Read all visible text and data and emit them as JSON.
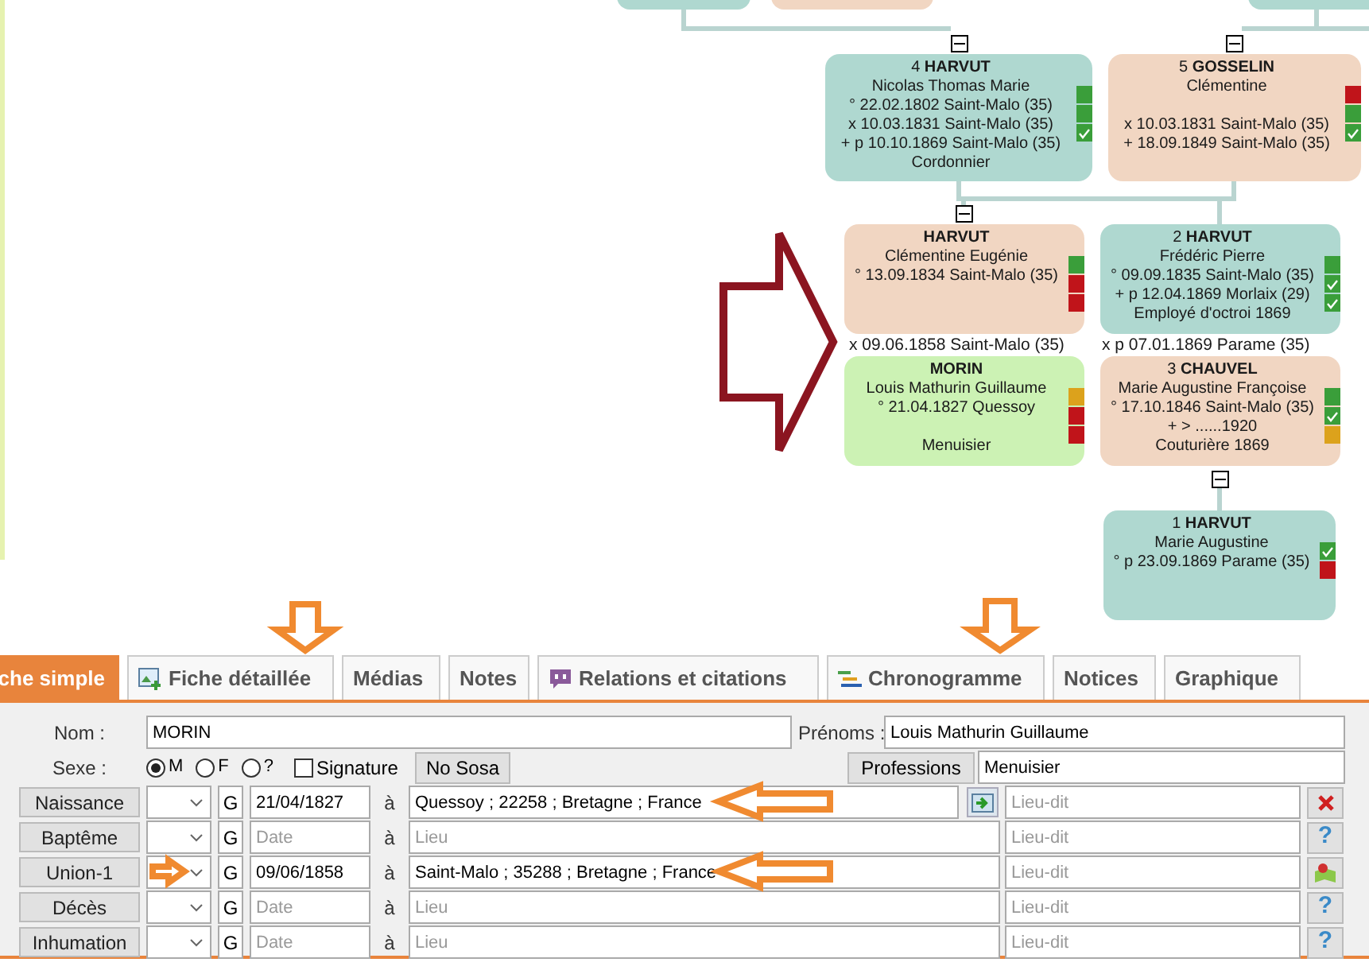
{
  "tree": {
    "nodes": [
      {
        "sosa": "4",
        "surname": "HARVUT",
        "given": "Nicolas Thomas Marie",
        "birth": "° 22.02.1802 Saint-Malo (35)",
        "marriage": "x 10.03.1831 Saint-Malo (35)",
        "death": "+ p 10.10.1869 Saint-Malo (35)",
        "occupation": "Cordonnier",
        "color": "#afd8d0",
        "markers": [
          {
            "color": "#3a9e3a",
            "checked": false
          },
          {
            "color": "#3a9e3a",
            "checked": false
          },
          {
            "color": "#3a9e3a",
            "checked": true
          }
        ]
      },
      {
        "sosa": "5",
        "surname": "GOSSELIN",
        "given": "Clémentine",
        "marriage": "x 10.03.1831 Saint-Malo (35)",
        "death": "+ 18.09.1849 Saint-Malo (35)",
        "color": "#f1d6c2",
        "markers": [
          {
            "color": "#c0141a",
            "checked": false
          },
          {
            "color": "#3a9e3a",
            "checked": false
          },
          {
            "color": "#3a9e3a",
            "checked": true
          }
        ]
      },
      {
        "surname": "HARVUT",
        "given": "Clémentine Eugénie",
        "birth": "° 13.09.1834 Saint-Malo (35)",
        "color": "#f1d6c2",
        "markers": [
          {
            "color": "#3a9e3a",
            "checked": false
          },
          {
            "color": "#c0141a",
            "checked": false
          },
          {
            "color": "#c0141a",
            "checked": false
          }
        ]
      },
      {
        "sosa": "2",
        "surname": "HARVUT",
        "given": "Frédéric Pierre",
        "birth": "° 09.09.1835 Saint-Malo (35)",
        "death": "+ p 12.04.1869 Morlaix (29)",
        "occupation": "Employé d'octroi 1869",
        "color": "#afd8d0",
        "markers": [
          {
            "color": "#3a9e3a",
            "checked": false
          },
          {
            "color": "#3a9e3a",
            "checked": true
          },
          {
            "color": "#3a9e3a",
            "checked": true
          }
        ]
      },
      {
        "surname": "MORIN",
        "given": "Louis Mathurin Guillaume",
        "birth": "° 21.04.1827 Quessoy",
        "occupation": "Menuisier",
        "color": "#ccf2b4",
        "markers": [
          {
            "color": "#dca21c",
            "checked": false
          },
          {
            "color": "#c0141a",
            "checked": false
          },
          {
            "color": "#c0141a",
            "checked": false
          }
        ]
      },
      {
        "sosa": "3",
        "surname": "CHAUVEL",
        "given": "Marie Augustine Françoise",
        "birth": "° 17.10.1846 Saint-Malo (35)",
        "death": "+ > ......1920",
        "occupation": "Couturière 1869",
        "color": "#f1d6c2",
        "markers": [
          {
            "color": "#3a9e3a",
            "checked": false
          },
          {
            "color": "#3a9e3a",
            "checked": true
          },
          {
            "color": "#dca21c",
            "checked": false
          }
        ]
      },
      {
        "sosa": "1",
        "surname": "HARVUT",
        "given": "Marie Augustine",
        "birth": "° p 23.09.1869 Parame (35)",
        "color": "#afd8d0",
        "markers": [
          {
            "color": "#3a9e3a",
            "checked": true
          },
          {
            "color": "#c0141a",
            "checked": false
          }
        ]
      }
    ],
    "unions": [
      "x 09.06.1858 Saint-Malo (35)",
      "x p 07.01.1869 Parame (35)"
    ]
  },
  "tabs": [
    {
      "label": "che simple",
      "selected": true
    },
    {
      "label": "Fiche détaillée",
      "selected": false,
      "kind": "card"
    },
    {
      "label": "Médias",
      "selected": false
    },
    {
      "label": "Notes",
      "selected": false
    },
    {
      "label": "Relations et citations",
      "selected": false,
      "kind": "speech"
    },
    {
      "label": "Chronogramme",
      "selected": false,
      "kind": "timeline"
    },
    {
      "label": "Notices",
      "selected": false
    },
    {
      "label": "Graphique",
      "selected": false
    }
  ],
  "form": {
    "nom_label": "Nom :",
    "nom": "MORIN",
    "prenoms_label": "Prénoms :",
    "prenoms": "Louis Mathurin Guillaume",
    "sexe_label": "Sexe :",
    "sexe": [
      {
        "label": "M",
        "selected": true
      },
      {
        "label": "F",
        "selected": false
      },
      {
        "label": "?",
        "selected": false
      }
    ],
    "signature": {
      "label": "Signature",
      "checked": false
    },
    "sosa_button": "No Sosa",
    "professions_button": "Professions",
    "profession": "Menuisier",
    "events": [
      {
        "label": "Naissance",
        "calendar": "G",
        "date": "21/04/1827",
        "place": "Quessoy ; 22258 ; Bretagne ; France",
        "focused": true,
        "lieu_dit_placeholder": "Lieu-dit",
        "at": "à",
        "action": {
          "kind": "delete"
        }
      },
      {
        "label": "Baptême",
        "calendar": "G",
        "date_placeholder": "Date",
        "place_placeholder": "Lieu",
        "focused": false,
        "lieu_dit_placeholder": "Lieu-dit",
        "at": "à",
        "action": {
          "kind": "help",
          "text": "?"
        }
      },
      {
        "label": "Union-1",
        "calendar": "G",
        "date": "09/06/1858",
        "place": "Saint-Malo ; 35288 ; Bretagne ; France",
        "focused": false,
        "lieu_dit_placeholder": "Lieu-dit",
        "at": "à",
        "action": {
          "kind": "map"
        }
      },
      {
        "label": "Décès",
        "calendar": "G",
        "date_placeholder": "Date",
        "place_placeholder": "Lieu",
        "focused": false,
        "lieu_dit_placeholder": "Lieu-dit",
        "at": "à",
        "action": {
          "kind": "help",
          "text": "?"
        }
      },
      {
        "label": "Inhumation",
        "calendar": "G",
        "date_placeholder": "Date",
        "place_placeholder": "Lieu",
        "focused": false,
        "lieu_dit_placeholder": "Lieu-dit",
        "at": "à",
        "action": {
          "kind": "help",
          "text": "?"
        }
      }
    ]
  }
}
